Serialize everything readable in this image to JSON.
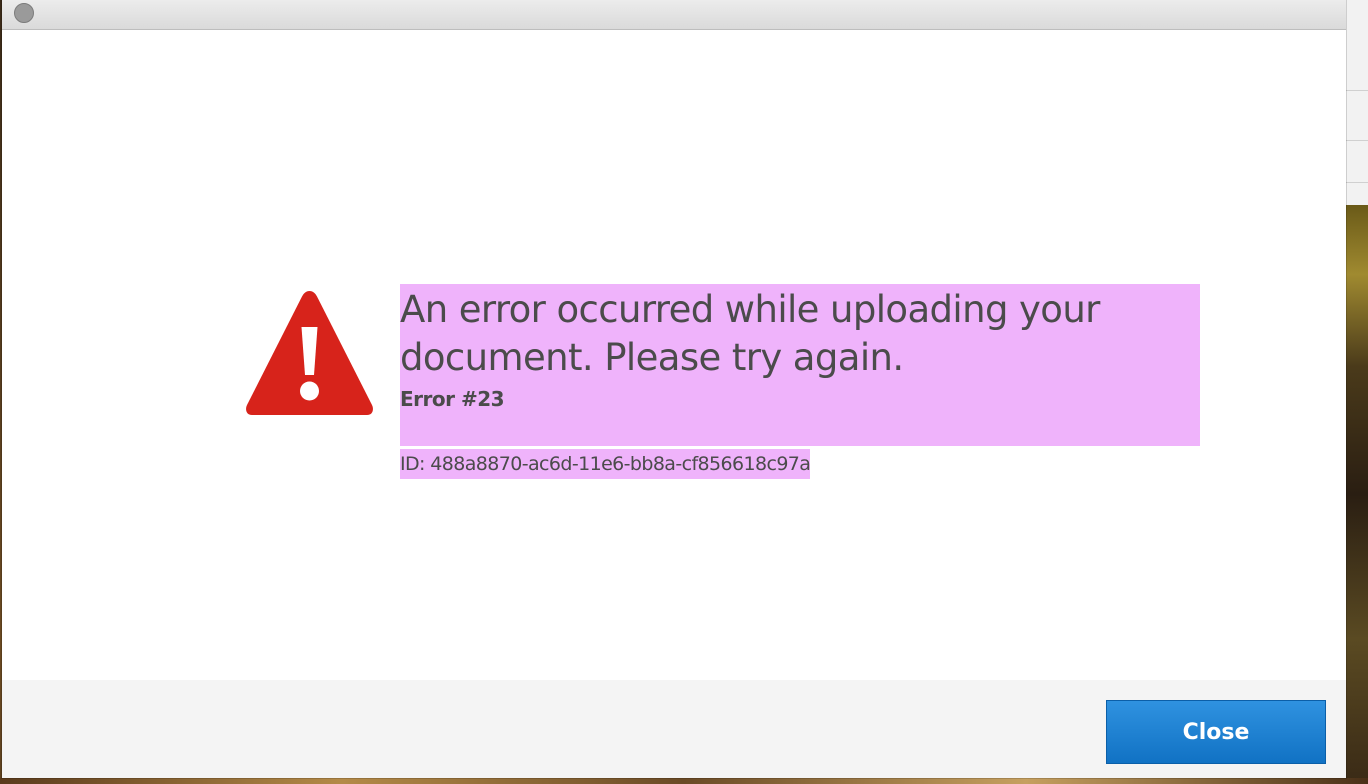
{
  "dialog": {
    "message": {
      "headline": "An error occurred while uploading your document. Please try again.",
      "error_code": "Error #23",
      "error_id": "ID: 488a8870-ac6d-11e6-bb8a-cf856618c97a"
    },
    "icon": "warning-icon",
    "footer": {
      "close_label": "Close"
    }
  },
  "colors": {
    "warning_red": "#d7231b",
    "highlight": "#efb3fb",
    "button_blue": "#1a80d2",
    "text": "#4b4b4b"
  }
}
